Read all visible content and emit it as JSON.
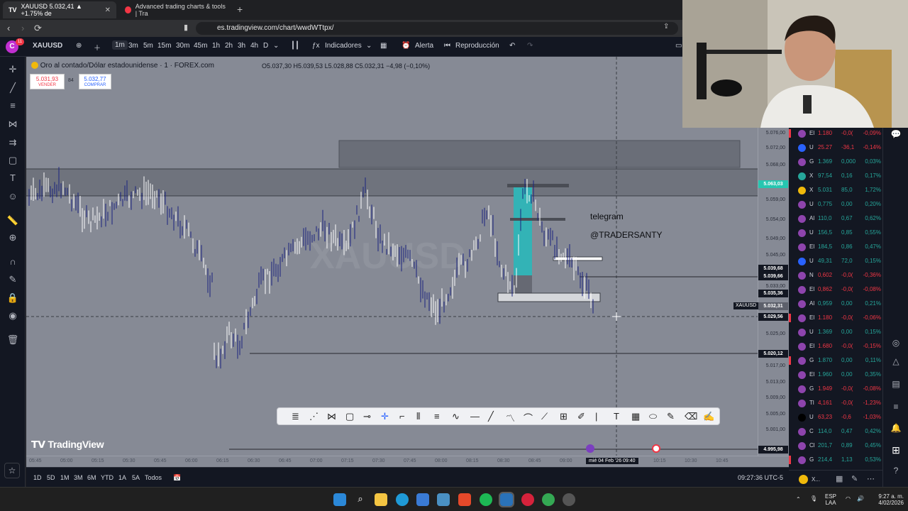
{
  "browser": {
    "tabs": [
      {
        "title": "XAUUSD 5.032,41 ▲ +1.75% de"
      },
      {
        "title": "Advanced trading charts & tools | Tra"
      }
    ],
    "url": "es.tradingview.com/chart/wwdWTtpx/"
  },
  "toolbar": {
    "avatar_letter": "C",
    "avatar_badge": "11",
    "symbol": "XAUUSD",
    "intervals": [
      "1m",
      "3m",
      "5m",
      "15m",
      "30m",
      "45m",
      "1h",
      "2h",
      "3h",
      "4h",
      "D"
    ],
    "selected_interval": "1m",
    "indicators_label": "Indicadores",
    "alert_label": "Alerta",
    "replay_label": "Reproducción"
  },
  "chart": {
    "title": "Oro al contado/Dólar estadounidense · 1 · FOREX.com",
    "ohlc": "O5.037,30  H5.039,53  L5.028,88  C5.032,31  −4,98 (−0,10%)",
    "sell_price": "5.031,93",
    "sell_label": "VENDER",
    "spread": "84",
    "buy_price": "5.032,77",
    "buy_label": "COMPRAR",
    "watermark_symbol": "XAUUSD",
    "annotation_line1": "telegram",
    "annotation_line2": "@TRADERSANTY",
    "brand": "TradingView",
    "price_labels": [
      "5.076,00",
      "5.072,00",
      "5.068,00",
      "5.059,00",
      "5.054,00",
      "5.049,00",
      "5.045,00",
      "5.033,00",
      "5.025,00",
      "5.017,00",
      "5.013,00",
      "5.009,00",
      "5.005,00",
      "5.001,00"
    ],
    "price_tags": [
      {
        "text": "5.063,03",
        "bg": "#26c6b0",
        "fg": "#ffffff"
      },
      {
        "text": "5.039,68",
        "bg": "#131722",
        "fg": "#ffffff"
      },
      {
        "text": "5.039,66",
        "bg": "#131722",
        "fg": "#ffffff"
      },
      {
        "text": "5.035,36",
        "bg": "#131722",
        "fg": "#ffffff"
      },
      {
        "text": "5.032,31",
        "bg": "#5d606b",
        "fg": "#ffffff"
      },
      {
        "text": "5.029,56",
        "bg": "#131722",
        "fg": "#ffffff"
      },
      {
        "text": "5.020,12",
        "bg": "#131722",
        "fg": "#ffffff"
      },
      {
        "text": "4.995,98",
        "bg": "#131722",
        "fg": "#ffffff"
      }
    ],
    "symbol_tag": "XAUUSD",
    "time_labels": [
      "05:45",
      "05:00",
      "05:15",
      "05:30",
      "05:45",
      "06:00",
      "06:15",
      "06:30",
      "06:45",
      "07:00",
      "07:15",
      "07:30",
      "07:45",
      "08:00",
      "08:15",
      "08:30",
      "08:45",
      "09:00",
      "09:15",
      "10:00",
      "10:15",
      "10:30",
      "10:45"
    ],
    "crosshair_time": "mié 04 Feb '26   09:40"
  },
  "bottom": {
    "ranges": [
      "1D",
      "5D",
      "1M",
      "3M",
      "6M",
      "YTD",
      "1A",
      "5A",
      "Todos"
    ],
    "clock": "09:27:36 UTC-5"
  },
  "watchlist": [
    {
      "sym": "El",
      "last": "1.180",
      "chg": "-0,0(",
      "pct": "-0,09%",
      "icon": "#8e44ad",
      "up": false,
      "flag": true
    },
    {
      "sym": "U",
      "last": "25.27",
      "chg": "-36,1",
      "pct": "-0,14%",
      "icon": "#2962ff",
      "up": false,
      "flag": false
    },
    {
      "sym": "G",
      "last": "1.369",
      "chg": "0,000",
      "pct": "0,03%",
      "icon": "#8e44ad",
      "up": true,
      "flag": false
    },
    {
      "sym": "X",
      "last": "97,54",
      "chg": "0,16",
      "pct": "0,17%",
      "icon": "#26a69a",
      "up": true,
      "flag": false
    },
    {
      "sym": "X",
      "last": "5.031",
      "chg": "85,0",
      "pct": "1,72%",
      "icon": "#f0b90b",
      "up": true,
      "flag": false
    },
    {
      "sym": "U",
      "last": "0,775",
      "chg": "0,00",
      "pct": "0,20%",
      "icon": "#8e44ad",
      "up": true,
      "flag": false
    },
    {
      "sym": "Al",
      "last": "110,0",
      "chg": "0,67",
      "pct": "0,62%",
      "icon": "#8e44ad",
      "up": true,
      "flag": false
    },
    {
      "sym": "U",
      "last": "156,5",
      "chg": "0,85",
      "pct": "0,55%",
      "icon": "#8e44ad",
      "up": true,
      "flag": false
    },
    {
      "sym": "El",
      "last": "184,5",
      "chg": "0,86",
      "pct": "0,47%",
      "icon": "#8e44ad",
      "up": true,
      "flag": false
    },
    {
      "sym": "U",
      "last": "49,31",
      "chg": "72,0",
      "pct": "0,15%",
      "icon": "#2962ff",
      "up": true,
      "flag": false
    },
    {
      "sym": "N",
      "last": "0,602",
      "chg": "-0,0(",
      "pct": "-0,36%",
      "icon": "#8e44ad",
      "up": false,
      "flag": false
    },
    {
      "sym": "El",
      "last": "0,862",
      "chg": "-0,0(",
      "pct": "-0,08%",
      "icon": "#8e44ad",
      "up": false,
      "flag": false
    },
    {
      "sym": "Al",
      "last": "0,959",
      "chg": "0,00",
      "pct": "0,21%",
      "icon": "#8e44ad",
      "up": true,
      "flag": false
    },
    {
      "sym": "El",
      "last": "1.180",
      "chg": "-0,0(",
      "pct": "-0,06%",
      "icon": "#8e44ad",
      "up": false,
      "flag": true
    },
    {
      "sym": "U",
      "last": "1.369",
      "chg": "0,00",
      "pct": "0,15%",
      "icon": "#8e44ad",
      "up": true,
      "flag": false
    },
    {
      "sym": "El",
      "last": "1.680",
      "chg": "-0,0(",
      "pct": "-0,15%",
      "icon": "#8e44ad",
      "up": false,
      "flag": false
    },
    {
      "sym": "G",
      "last": "1.870",
      "chg": "0,00",
      "pct": "0,11%",
      "icon": "#8e44ad",
      "up": true,
      "flag": true
    },
    {
      "sym": "El",
      "last": "1.960",
      "chg": "0,00",
      "pct": "0,35%",
      "icon": "#8e44ad",
      "up": true,
      "flag": false
    },
    {
      "sym": "G",
      "last": "1.949",
      "chg": "-0,0(",
      "pct": "-0,08%",
      "icon": "#8e44ad",
      "up": false,
      "flag": false
    },
    {
      "sym": "Tl",
      "last": "4,161",
      "chg": "-0,0(",
      "pct": "-1,23%",
      "icon": "#8e44ad",
      "up": false,
      "flag": false
    },
    {
      "sym": "U",
      "last": "63,23",
      "chg": "-0,6",
      "pct": "-1,03%",
      "icon": "#000000",
      "up": false,
      "flag": false
    },
    {
      "sym": "C",
      "last": "114,0",
      "chg": "0,47",
      "pct": "0,42%",
      "icon": "#8e44ad",
      "up": true,
      "flag": false
    },
    {
      "sym": "Cl",
      "last": "201,7",
      "chg": "0,89",
      "pct": "0,45%",
      "icon": "#8e44ad",
      "up": true,
      "flag": false
    },
    {
      "sym": "G",
      "last": "214,4",
      "chg": "1,13",
      "pct": "0,53%",
      "icon": "#8e44ad",
      "up": true,
      "flag": true
    }
  ],
  "watch_footer": "X...",
  "taskbar": {
    "lang_top": "ESP",
    "lang_bottom": "LAA",
    "time": "9:27 a. m.",
    "date": "4/02/2026"
  },
  "colors": {
    "up": "#26a69a",
    "down": "#f23645",
    "accent": "#2962ff"
  }
}
